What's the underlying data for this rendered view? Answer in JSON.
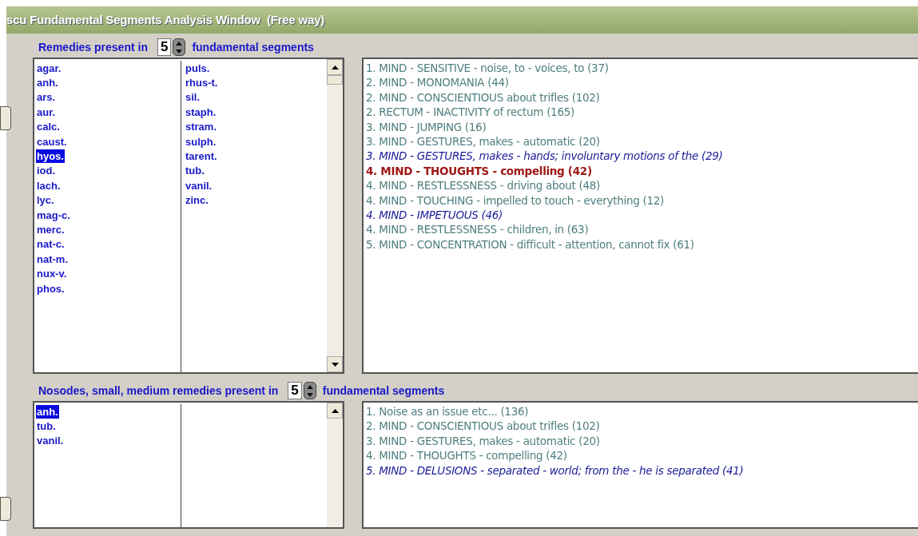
{
  "window": {
    "title": "scu Fundamental Segments Analysis Window  (Free way)"
  },
  "sections": [
    {
      "label_before": "Remedies present in",
      "count": "5",
      "label_after": "fundamental segments",
      "remedy_columns": [
        [
          {
            "label": "agar.",
            "selected": false
          },
          {
            "label": "anh.",
            "selected": false
          },
          {
            "label": "ars.",
            "selected": false
          },
          {
            "label": "aur.",
            "selected": false
          },
          {
            "label": "calc.",
            "selected": false
          },
          {
            "label": "caust.",
            "selected": false
          },
          {
            "label": "hyos.",
            "selected": true
          },
          {
            "label": "iod.",
            "selected": false
          },
          {
            "label": "lach.",
            "selected": false
          },
          {
            "label": "lyc.",
            "selected": false
          },
          {
            "label": "mag-c.",
            "selected": false
          },
          {
            "label": "merc.",
            "selected": false
          },
          {
            "label": "nat-c.",
            "selected": false
          },
          {
            "label": "nat-m.",
            "selected": false
          },
          {
            "label": "nux-v.",
            "selected": false
          },
          {
            "label": "phos.",
            "selected": false
          }
        ],
        [
          {
            "label": "puls.",
            "selected": false
          },
          {
            "label": "rhus-t.",
            "selected": false
          },
          {
            "label": "sil.",
            "selected": false
          },
          {
            "label": "staph.",
            "selected": false
          },
          {
            "label": "stram.",
            "selected": false
          },
          {
            "label": "sulph.",
            "selected": false
          },
          {
            "label": "tarent.",
            "selected": false
          },
          {
            "label": "tub.",
            "selected": false
          },
          {
            "label": "vanil.",
            "selected": false
          },
          {
            "label": "zinc.",
            "selected": false
          }
        ]
      ],
      "rubrics": [
        {
          "text": "1. MIND - SENSITIVE - noise, to - voices, to (37)",
          "kind": "normal"
        },
        {
          "text": "2. MIND - MONOMANIA (44)",
          "kind": "normal"
        },
        {
          "text": "2. MIND - CONSCIENTIOUS about trifles (102)",
          "kind": "normal"
        },
        {
          "text": "2. RECTUM - INACTIVITY of rectum (165)",
          "kind": "normal"
        },
        {
          "text": "3. MIND - JUMPING (16)",
          "kind": "normal"
        },
        {
          "text": "3. MIND - GESTURES, makes - automatic (20)",
          "kind": "normal"
        },
        {
          "text": "3. MIND - GESTURES, makes - hands; involuntary motions of the (29)",
          "kind": "emphasis"
        },
        {
          "text": "4. MIND - THOUGHTS - compelling (42)",
          "kind": "highlight"
        },
        {
          "text": "4. MIND - RESTLESSNESS - driving about (48)",
          "kind": "normal"
        },
        {
          "text": "4. MIND - TOUCHING - impelled to touch - everything (12)",
          "kind": "normal"
        },
        {
          "text": "4. MIND - IMPETUOUS (46)",
          "kind": "emphasis"
        },
        {
          "text": "4. MIND - RESTLESSNESS - children, in (63)",
          "kind": "normal"
        },
        {
          "text": "5. MIND - CONCENTRATION - difficult - attention, cannot fix (61)",
          "kind": "normal"
        }
      ]
    },
    {
      "label_before": "Nosodes, small, medium remedies present in",
      "count": "5",
      "label_after": "fundamental segments",
      "remedy_columns": [
        [
          {
            "label": "anh.",
            "selected": true
          },
          {
            "label": "tub.",
            "selected": false
          },
          {
            "label": "vanil.",
            "selected": false
          }
        ],
        []
      ],
      "rubrics": [
        {
          "text": "1. Noise as an issue etc... (136)",
          "kind": "normal"
        },
        {
          "text": "2. MIND - CONSCIENTIOUS about trifles (102)",
          "kind": "normal"
        },
        {
          "text": "3. MIND - GESTURES, makes - automatic (20)",
          "kind": "normal"
        },
        {
          "text": "4. MIND - THOUGHTS - compelling (42)",
          "kind": "normal"
        },
        {
          "text": "5. MIND - DELUSIONS - separated - world; from the - he is separated (41)",
          "kind": "emphasis"
        }
      ]
    }
  ]
}
